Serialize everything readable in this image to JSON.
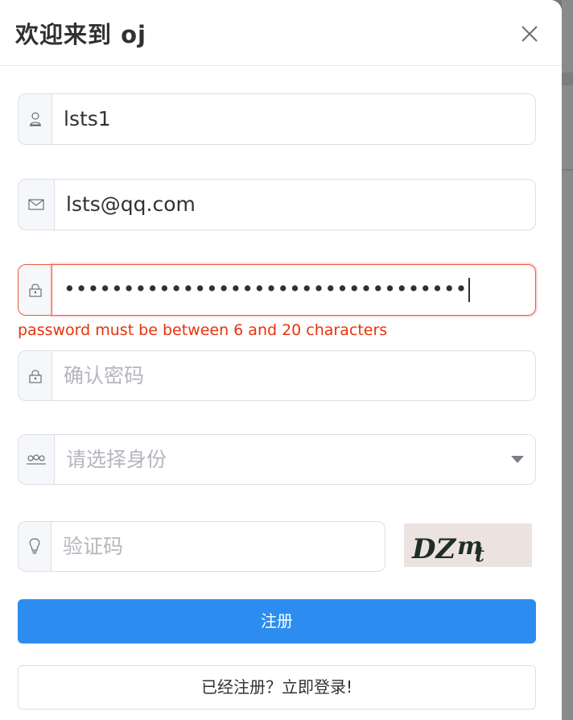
{
  "dialog": {
    "title": "欢迎来到 oj",
    "close_icon": "close-icon"
  },
  "form": {
    "username": {
      "icon": "user-icon",
      "value": "lsts1"
    },
    "email": {
      "icon": "mail-icon",
      "value": "lsts@qq.com"
    },
    "password": {
      "icon": "lock-icon",
      "value": "••••••••••••••••••••••••••••••••••",
      "error": "password must be between 6 and 20 characters"
    },
    "confirm_password": {
      "icon": "lock-icon",
      "placeholder": "确认密码"
    },
    "identity": {
      "icon": "group-icon",
      "placeholder": "请选择身份",
      "arrow_icon": "caret-down-icon"
    },
    "captcha": {
      "icon": "lightbulb-icon",
      "placeholder": "验证码",
      "image_text": "DZ mt"
    }
  },
  "buttons": {
    "register": "注册",
    "login_link": "已经注册？立即登录!"
  },
  "colors": {
    "primary": "#2d8cf0",
    "error": "#e8320c",
    "border": "#dcdfe6",
    "prepend_bg": "#f5f7fa"
  }
}
